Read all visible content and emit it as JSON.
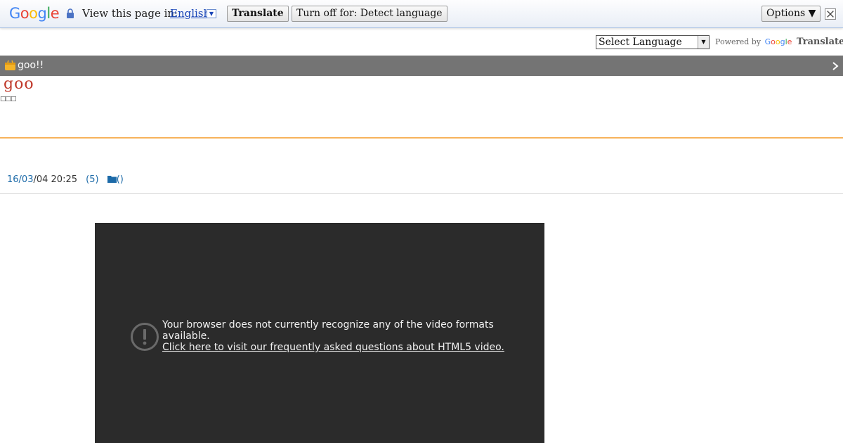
{
  "translate_bar": {
    "logo": {
      "letters": [
        "G",
        "o",
        "o",
        "g",
        "l",
        "e"
      ],
      "colors": [
        "#4285f4",
        "#ea4335",
        "#fbbc05",
        "#4285f4",
        "#34a853",
        "#ea4335"
      ]
    },
    "view_label": "View this page in:",
    "language": "English",
    "translate_button": "Translate",
    "turn_off_button": "Turn off for: Detect language",
    "options_button": "Options ▼"
  },
  "language_widget": {
    "select_value": "Select Language",
    "powered_by": "Powered by",
    "google": "Google",
    "translate": "Translate"
  },
  "site": {
    "name": "goo!!",
    "brand": "goo",
    "subtitle": "□□□",
    "colors": {
      "header": "#747474",
      "brand": "#c0392b",
      "rule": "#f7b35c",
      "link": "#1c6aa8"
    }
  },
  "post_meta": {
    "date_part1": "16/03",
    "date_part2": "/04 20:25",
    "comments": "(5)",
    "category": "()"
  },
  "video": {
    "message": "Your browser does not currently recognize any of the video formats available.",
    "link_text": "Click here to visit our frequently asked questions about HTML5 video."
  }
}
